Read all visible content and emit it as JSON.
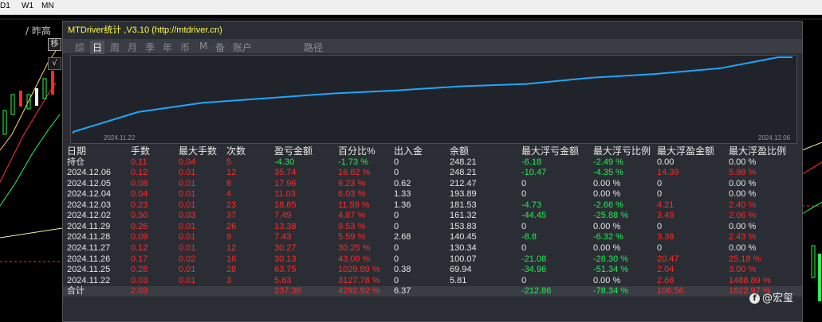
{
  "timeframes": [
    "D1",
    "W1",
    "MN"
  ],
  "left_label": "/ 昨高",
  "left_buttons": [
    "移",
    "√"
  ],
  "panel": {
    "title": "MTDriver统计 ,V3.10 (http://mtdriver.cn)",
    "tabs": [
      "综",
      "日",
      "周",
      "月",
      "季",
      "年",
      "币",
      "M",
      "备",
      "账户",
      "路径"
    ],
    "active_tab": "日",
    "graph": {
      "start_label": "2024.11.22",
      "end_label": "2024.12.06",
      "balance": [
        5.81,
        69.94,
        100.07,
        130.34,
        140.45,
        153.83,
        161.32,
        181.53,
        193.89,
        212.47,
        248.21,
        248.21
      ],
      "line_color": "#1ea7ff"
    }
  },
  "table": {
    "headers": [
      "日期",
      "手数",
      "最大手数",
      "次数",
      "盈亏金额",
      "百分比%",
      "出入金",
      "余额",
      "最大浮亏金额",
      "最大浮亏比例",
      "最大浮盈金额",
      "最大浮盈比例"
    ],
    "holding": [
      "持仓",
      "0.11",
      "0.04",
      "5",
      "-4.30",
      "-1.73 %",
      "0",
      "248.21",
      "-6.18",
      "-2.49 %",
      "0.00",
      "0.00 %"
    ],
    "rows": [
      [
        "2024.12.06",
        "0.12",
        "0.01",
        "12",
        "35.74",
        "16.82 %",
        "0",
        "248.21",
        "-10.47",
        "-4.35 %",
        "14.39",
        "5.98 %"
      ],
      [
        "2024.12.05",
        "0.08",
        "0.01",
        "8",
        "17.96",
        "9.23 %",
        "0.62",
        "212.47",
        "0",
        "0.00 %",
        "0",
        "0.00 %"
      ],
      [
        "2024.12.04",
        "0.04",
        "0.01",
        "4",
        "11.03",
        "6.03 %",
        "1.33",
        "193.89",
        "0",
        "0.00 %",
        "0",
        "0.00 %"
      ],
      [
        "2024.12.03",
        "0.23",
        "0.01",
        "23",
        "18.85",
        "11.59 %",
        "1.36",
        "181.53",
        "-4.73",
        "-2.66 %",
        "4.21",
        "2.40 %"
      ],
      [
        "2024.12.02",
        "0.50",
        "0.03",
        "37",
        "7.49",
        "4.87 %",
        "0",
        "161.32",
        "-44.45",
        "-25.88 %",
        "3.49",
        "2.06 %"
      ],
      [
        "2024.11.29",
        "0.26",
        "0.01",
        "26",
        "13.38",
        "9.53 %",
        "0",
        "153.83",
        "0",
        "0.00 %",
        "0",
        "0.00 %"
      ],
      [
        "2024.11.28",
        "0.09",
        "0.01",
        "9",
        "7.43",
        "5.59 %",
        "2.68",
        "140.45",
        "-8.8",
        "-6.32 %",
        "3.38",
        "2.43 %"
      ],
      [
        "2024.11.27",
        "0.12",
        "0.01",
        "12",
        "30.27",
        "30.25 %",
        "0",
        "130.34",
        "0",
        "0.00 %",
        "0",
        "0.00 %"
      ],
      [
        "2024.11.26",
        "0.17",
        "0.02",
        "16",
        "30.13",
        "43.08 %",
        "0",
        "100.07",
        "-21.08",
        "-26.30 %",
        "20.47",
        "25.18 %"
      ],
      [
        "2024.11.25",
        "0.28",
        "0.01",
        "28",
        "63.75",
        "1029.89 %",
        "0.38",
        "69.94",
        "-34.96",
        "-51.34 %",
        "2.04",
        "3.00 %"
      ],
      [
        "2024.11.22",
        "0.03",
        "0.01",
        "3",
        "5.63",
        "3127.78 %",
        "0",
        "5.81",
        "0",
        "0.00 %",
        "2.68",
        "1488.89 %"
      ]
    ],
    "total": [
      "合计",
      "2.03",
      "",
      "",
      "237.36",
      "4292.92 %",
      "6.37",
      "",
      "-212.86",
      "-78.34 %",
      "106.56",
      "1622.97 %"
    ]
  },
  "watermark": {
    "icon": "f",
    "text": "@宏玺"
  },
  "colors": {
    "profit": "#ff2a2a",
    "loss": "#22ee55",
    "neutral": "#e6e6e6",
    "title": "#ffff40"
  }
}
